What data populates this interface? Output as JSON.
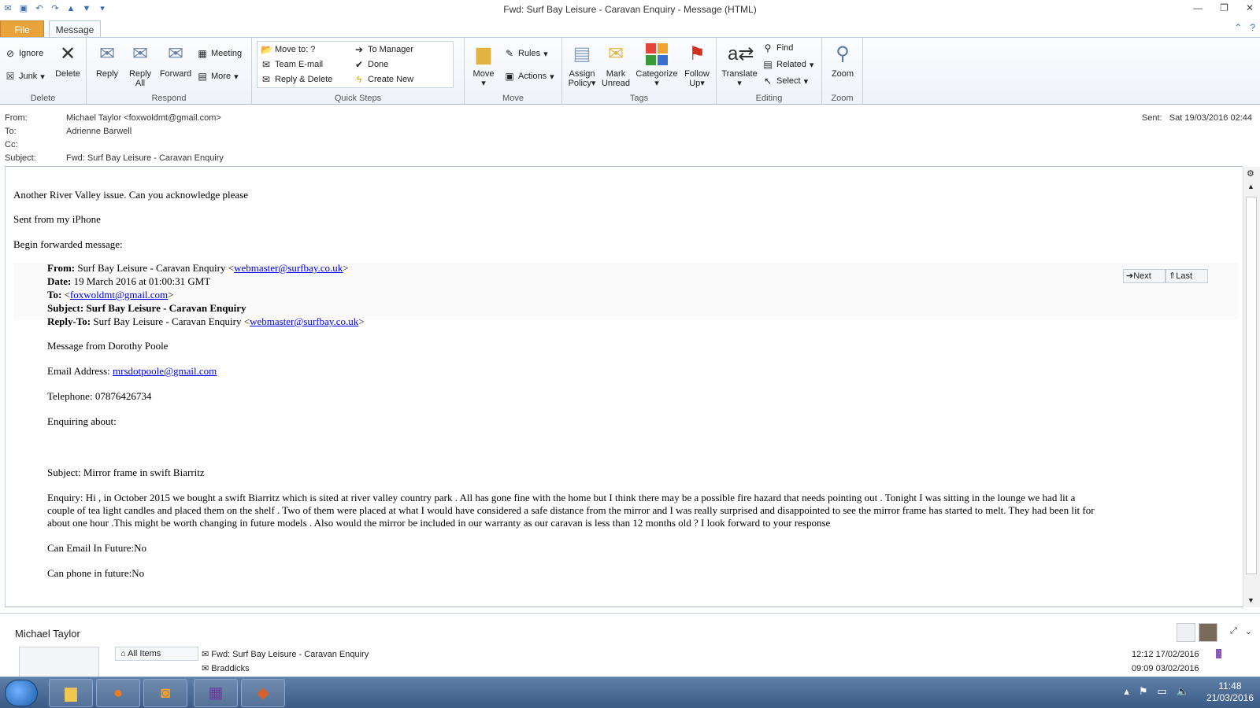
{
  "window": {
    "title": "Fwd: Surf Bay Leisure - Caravan Enquiry  -  Message (HTML)"
  },
  "tabs": {
    "file": "File",
    "message": "Message"
  },
  "ribbon": {
    "delete": {
      "label": "Delete",
      "ignore": "Ignore",
      "junk": "Junk",
      "delete": "Delete"
    },
    "respond": {
      "label": "Respond",
      "reply": "Reply",
      "reply_all_1": "Reply",
      "reply_all_2": "All",
      "forward": "Forward",
      "meeting": "Meeting",
      "more": "More"
    },
    "quick_steps": {
      "label": "Quick Steps",
      "items": [
        "Move to: ?",
        "Team E-mail",
        "Reply & Delete",
        "To Manager",
        "Done",
        "Create New"
      ]
    },
    "move": {
      "label": "Move",
      "move": "Move",
      "rules": "Rules",
      "actions": "Actions"
    },
    "tags": {
      "label": "Tags",
      "assign_1": "Assign",
      "assign_2": "Policy",
      "mark_1": "Mark",
      "mark_2": "Unread",
      "categorize": "Categorize",
      "follow_1": "Follow",
      "follow_2": "Up"
    },
    "editing": {
      "label": "Editing",
      "translate": "Translate",
      "find": "Find",
      "related": "Related",
      "select": "Select"
    },
    "zoom": {
      "label": "Zoom",
      "zoom": "Zoom"
    }
  },
  "header": {
    "from_label": "From:",
    "from": "Michael Taylor <foxwoldmt@gmail.com>",
    "to_label": "To:",
    "to": "Adrienne Barwell",
    "cc_label": "Cc:",
    "cc": "",
    "subject_label": "Subject:",
    "subject": "Fwd: Surf Bay Leisure - Caravan Enquiry",
    "sent_label": "Sent:",
    "sent": "Sat 19/03/2016 02:44"
  },
  "body": {
    "line1": "Another River Valley issue. Can you acknowledge please",
    "line2": "Sent from my iPhone",
    "line3": "Begin forwarded message:",
    "fwd_from_label": "From:",
    "fwd_from_pre": "Surf Bay Leisure - Caravan Enquiry <",
    "fwd_from_email": "webmaster@surfbay.co.uk",
    "fwd_from_post": ">",
    "fwd_date_label": "Date:",
    "fwd_date": "19 March 2016 at 01:00:31 GMT",
    "fwd_to_label": "To:",
    "fwd_to_pre": "<",
    "fwd_to_email": "foxwoldmt@gmail.com",
    "fwd_to_post": ">",
    "fwd_subject_label": "Subject:",
    "fwd_subject": "Surf Bay Leisure - Caravan Enquiry",
    "fwd_replyto_label": "Reply-To:",
    "fwd_replyto_pre": "Surf Bay Leisure - Caravan Enquiry <",
    "fwd_replyto_email": "webmaster@surfbay.co.uk",
    "fwd_replyto_post": ">",
    "nav_next": "Next",
    "nav_last": "Last",
    "msg_from": "Message from Dorothy Poole",
    "email_label": "Email Address:",
    "email": "mrsdotpoole@gmail.com",
    "telephone": "Telephone: 07876426734",
    "enquiring": "Enquiring about:",
    "subject_line": "Subject: Mirror frame in swift Biarritz",
    "enquiry_1": "Enquiry: Hi , in October 2015 we bought a swift Biarritz which is sited at river valley country park . All has gone fine with the home but I think there may be a possible fire hazard that needs pointing out . Tonight I was sitting in the lounge we had lit a",
    "enquiry_2": "couple of tea light candles and placed them on the shelf . Two of them were placed at what I would have considered a safe distance from the mirror and I was really surprised and disappointed to see the mirror frame has started to melt. They had been lit for",
    "enquiry_3": "about one hour .This might be worth changing in future models . Also would the mirror be included in our warranty as our caravan is less than 12 months old ? I look forward to your response",
    "can_email": "Can Email In Future:No",
    "can_phone": "Can phone in future:No"
  },
  "people_pane": {
    "name": "Michael Taylor",
    "all_items": "All Items",
    "item1": "Fwd: Surf Bay Leisure - Caravan Enquiry",
    "item1_date": "12:12  17/02/2016",
    "item2": "Braddicks",
    "item2_date": "09:09  03/02/2016"
  },
  "taskbar": {
    "time": "11:48",
    "date": "21/03/2016"
  }
}
